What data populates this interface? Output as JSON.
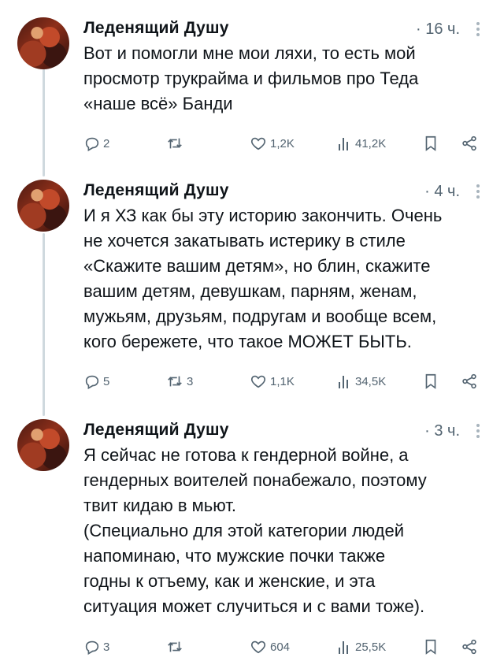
{
  "tweets": [
    {
      "author": "Леденящий Душу",
      "time": "· 16 ч.",
      "text": "Вот и помогли мне мои ляхи, то есть мой\nпросмотр трукрайма и фильмов про Теда\n«наше всё» Банди",
      "replies": "2",
      "retweets": "",
      "likes": "1,2K",
      "views": "41,2K"
    },
    {
      "author": "Леденящий Душу",
      "time": "· 4 ч.",
      "text": "И я ХЗ как бы эту историю закончить. Очень\nне хочется закатывать истерику в стиле\n«Скажите вашим детям», но блин, скажите\nвашим детям, девушкам, парням, женам,\nмужьям, друзьям, подругам и вообще всем,\nкого бережете, что такое МОЖЕТ БЫТЬ.",
      "replies": "5",
      "retweets": "3",
      "likes": "1,1K",
      "views": "34,5K"
    },
    {
      "author": "Леденящий Душу",
      "time": "· 3 ч.",
      "text": "Я сейчас не готова к гендерной войне, а\nгендерных воителей понабежало, поэтому\nтвит кидаю в мьют.\n(Специально для этой категории людей\nнапоминаю, что мужские почки также\nгодны к отъему, как и женские, и эта\nситуация может случиться и с вами тоже).",
      "replies": "3",
      "retweets": "",
      "likes": "604",
      "views": "25,5K"
    }
  ],
  "icons": [
    "reply-icon",
    "retweet-icon",
    "like-icon",
    "views-icon",
    "bookmark-icon",
    "share-icon",
    "more-icon"
  ],
  "colors": {
    "text": "#0f1419",
    "muted": "#536471",
    "thread_line": "#cfd9de"
  }
}
